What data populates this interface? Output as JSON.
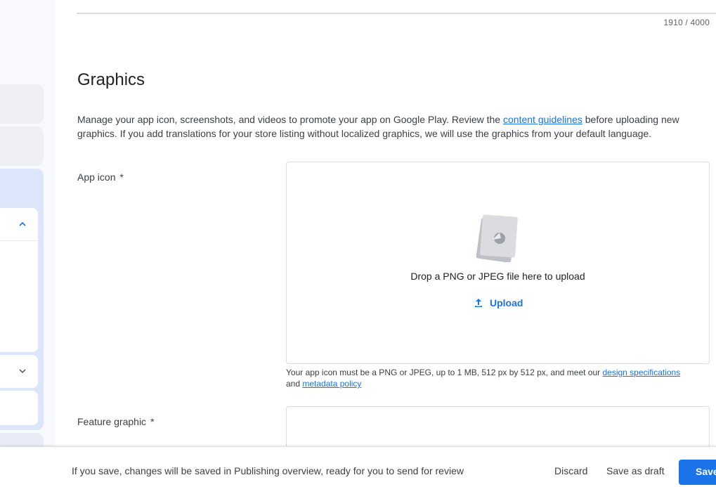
{
  "header": {
    "char_count": "1910 / 4000"
  },
  "graphics": {
    "title": "Graphics",
    "desc_before": "Manage your app icon, screenshots, and videos to promote your app on Google Play. Review the ",
    "desc_link": "content guidelines",
    "desc_after": " before uploading new graphics. If you add translations for your store listing without localized graphics, we will use the graphics from your default language."
  },
  "app_icon": {
    "label": "App icon",
    "required_mark": "*",
    "drop_text": "Drop a PNG or JPEG file here to upload",
    "upload_label": "Upload",
    "helper_before": "Your app icon must be a PNG or JPEG, up to 1 MB, 512 px by 512 px, and meet our ",
    "helper_link1": "design specifications",
    "helper_mid": " and ",
    "helper_link2": "metadata policy"
  },
  "feature_graphic": {
    "label": "Feature graphic",
    "required_mark": "*"
  },
  "footer": {
    "message": "If you save, changes will be saved in Publishing overview, ready for you to send for review",
    "discard_label": "Discard",
    "draft_label": "Save as draft",
    "save_label": "Save"
  },
  "colors": {
    "accent": "#1a73e8",
    "sidebar_active": "#dce6fb"
  }
}
